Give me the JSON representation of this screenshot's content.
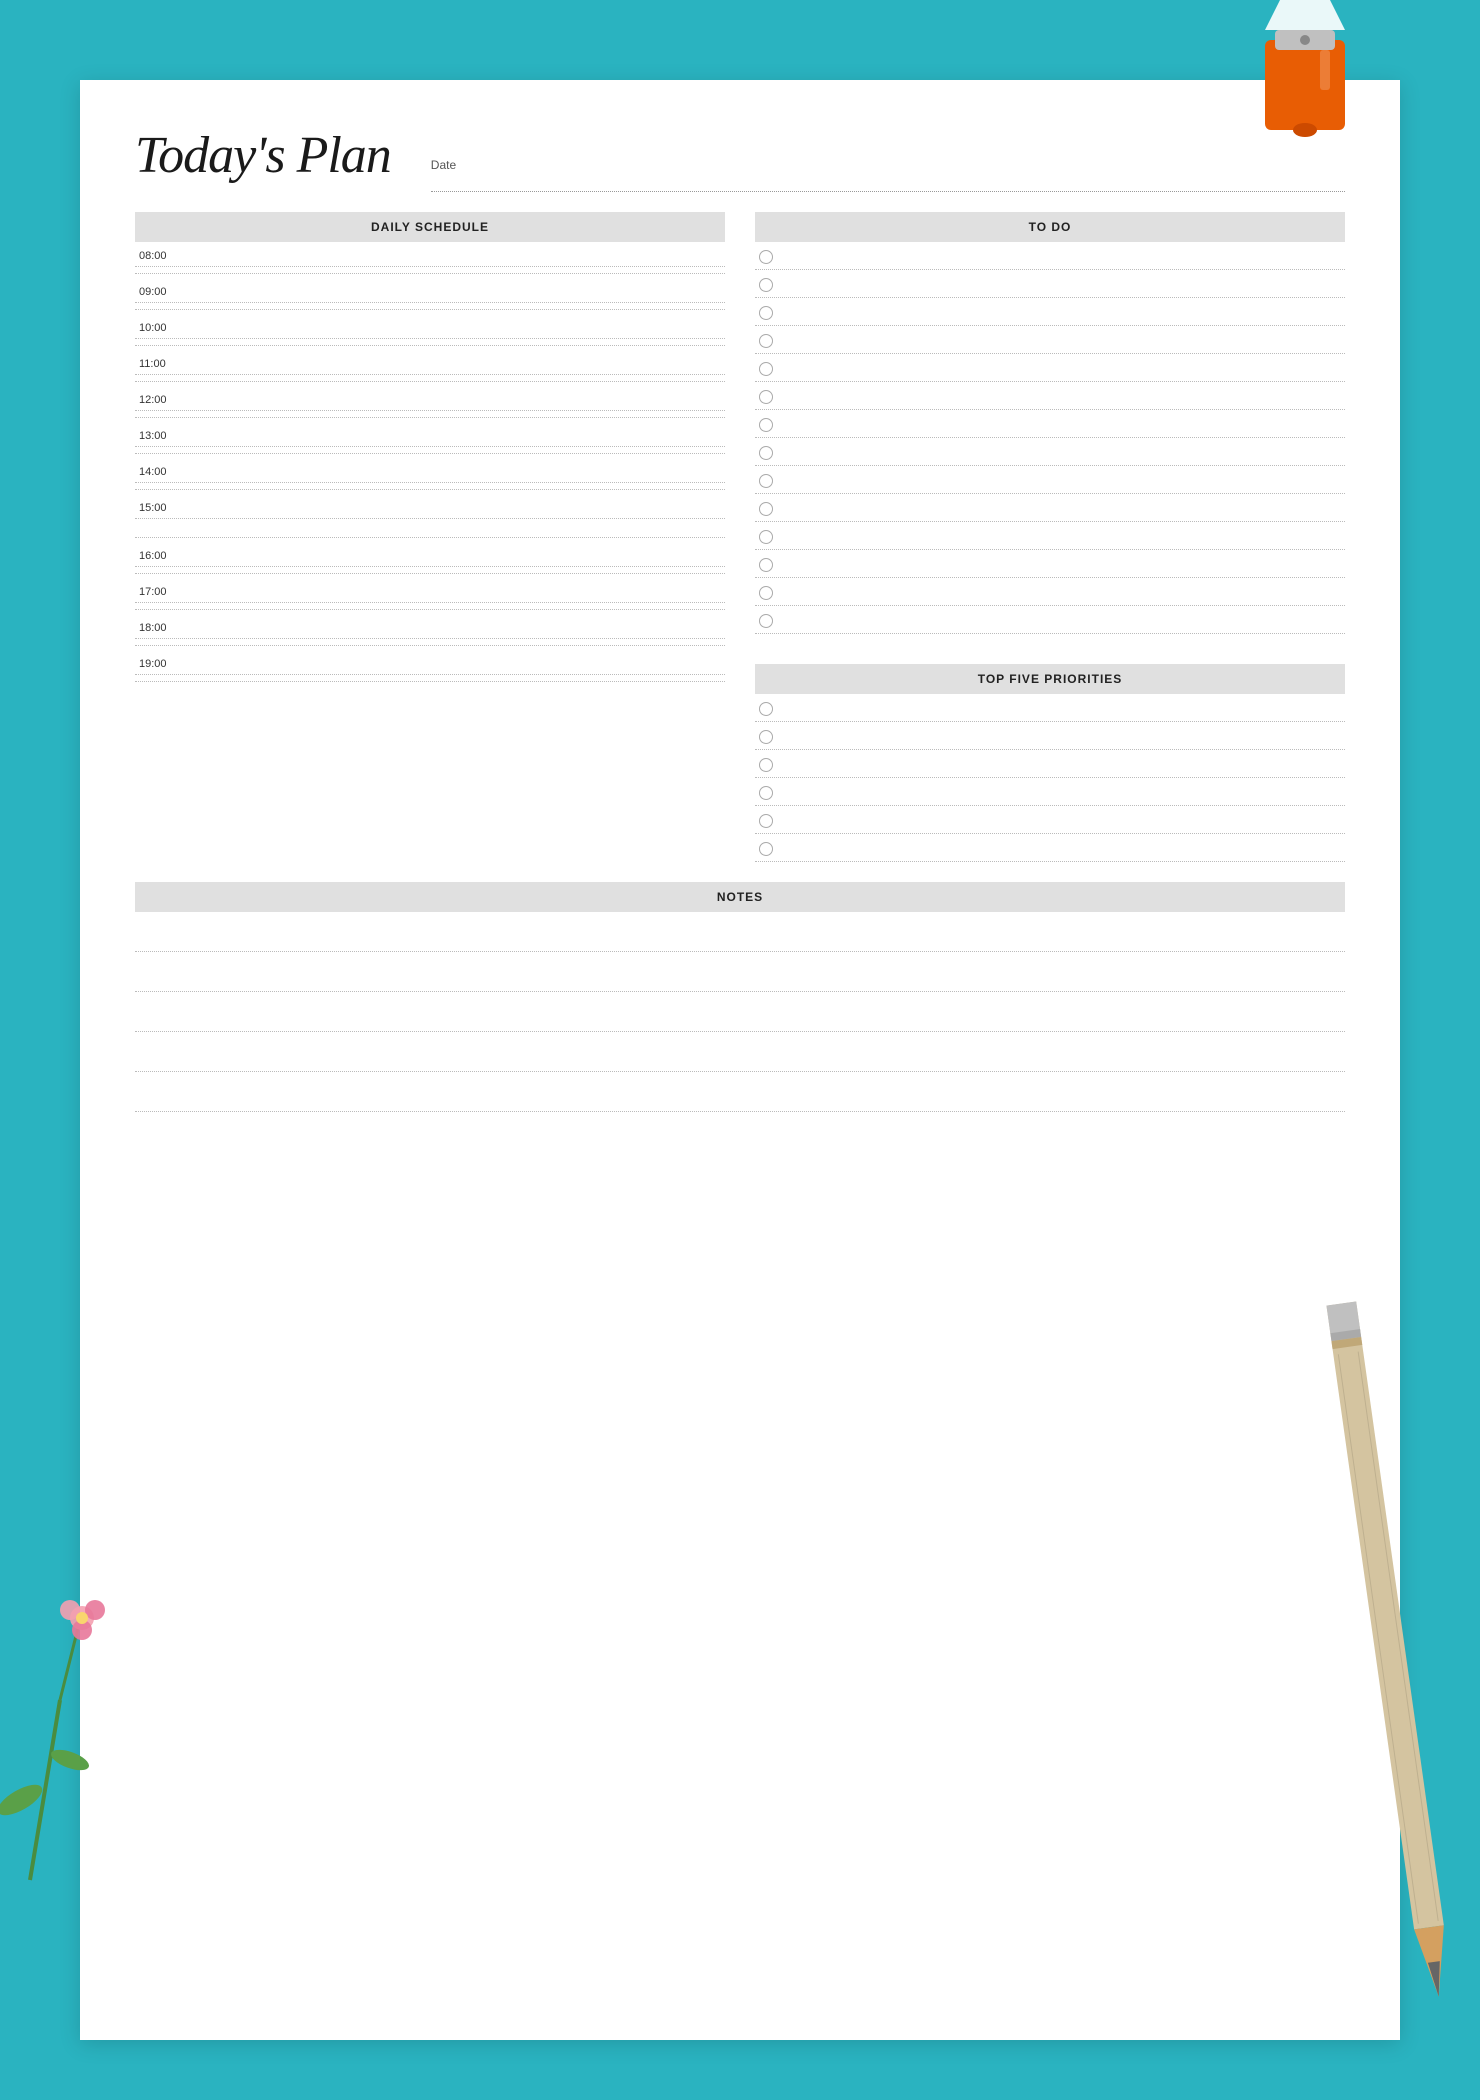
{
  "page": {
    "bg_color": "#2ab3c0"
  },
  "header": {
    "title": "Today's Plan",
    "date_label": "Date"
  },
  "schedule": {
    "section_title": "DAILY SCHEDULE",
    "times": [
      "08:00",
      "09:00",
      "10:00",
      "11:00",
      "12:00",
      "13:00",
      "14:00",
      "15:00",
      "16:00",
      "17:00",
      "18:00",
      "19:00"
    ]
  },
  "todo": {
    "section_title": "TO DO",
    "items": 14
  },
  "priorities": {
    "section_title": "TOP FIVE PRIORITIES",
    "items": 6
  },
  "notes": {
    "section_title": "NOTES",
    "lines": 5
  }
}
